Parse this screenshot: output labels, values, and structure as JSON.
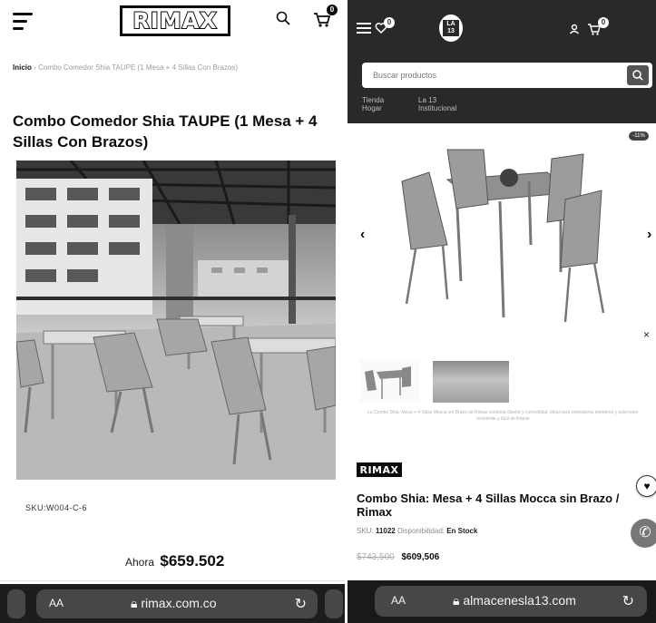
{
  "left": {
    "logo_text": "RIMAX",
    "cart_count": "0",
    "breadcrumb": {
      "home": "Inicio",
      "sep": "›",
      "current": "Combo Comedor Shia TAUPE (1 Mesa + 4 Sillas Con Brazos)"
    },
    "product_title": "Combo Comedor Shia TAUPE (1 Mesa + 4 Sillas Con Brazos)",
    "sku": "SKU:W004-C-6",
    "price_label": "Ahora",
    "price": "$659.502",
    "browser": {
      "aa": "AA",
      "url": "rimax.com.co",
      "reload": "↻"
    }
  },
  "right": {
    "wishlist_count": "0",
    "cart_count": "0",
    "logo_line1": "LA",
    "logo_line2": "13",
    "search_placeholder": "Buscar productos",
    "nav": [
      {
        "line1": "Tienda",
        "line2": "Hogar"
      },
      {
        "line1": "La 13",
        "line2": "Institucional"
      }
    ],
    "discount_badge": "-11%",
    "gallery_prev": "‹",
    "gallery_next": "›",
    "close": "×",
    "description": "La Combo Shia: Mesa + 4 Sillas Mocca sin Brazo de Rimax combina diseño y comodidad, ideal para comedores interiores y exteriores, resistente y fácil de limpiar.",
    "brand_logo": "RIMAX",
    "product_title": "Combo Shia: Mesa + 4 Sillas Mocca sin Brazo / Rimax",
    "sku_label": "SKU:",
    "sku": "11022",
    "availability_label": "Disponibilidad:",
    "availability": "En Stock",
    "old_price": "$743,500",
    "price": "$609,506",
    "browser": {
      "aa": "AA",
      "url": "almacenesla13.com",
      "reload": "↻"
    }
  },
  "colors": {
    "header_dark": "#2d2d2d",
    "text": "#111111"
  }
}
